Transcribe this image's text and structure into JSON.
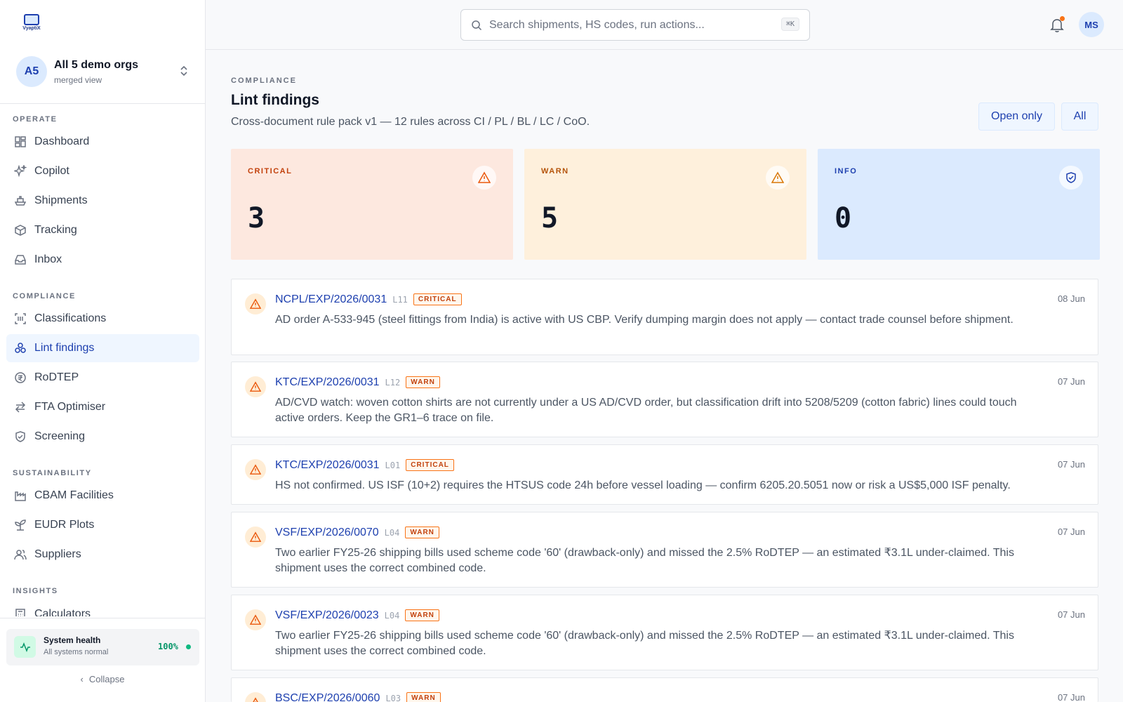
{
  "brand": {
    "logo_text": "VyaptiX"
  },
  "org": {
    "initials": "A5",
    "name": "All 5 demo orgs",
    "sub": "merged view"
  },
  "nav": {
    "operate": "OPERATE",
    "compliance": "COMPLIANCE",
    "sustainability": "SUSTAINABILITY",
    "insights": "INSIGHTS",
    "items": {
      "dashboard": "Dashboard",
      "copilot": "Copilot",
      "shipments": "Shipments",
      "tracking": "Tracking",
      "inbox": "Inbox",
      "classifications": "Classifications",
      "lint_findings": "Lint findings",
      "rodtep": "RoDTEP",
      "fta": "FTA Optimiser",
      "screening": "Screening",
      "cbam": "CBAM Facilities",
      "eudr": "EUDR Plots",
      "suppliers": "Suppliers",
      "calculators": "Calculators"
    }
  },
  "health": {
    "title": "System health",
    "sub": "All systems normal",
    "value": "100%"
  },
  "collapse": "Collapse",
  "search": {
    "placeholder": "Search shipments, HS codes, run actions...",
    "shortcut": "⌘K"
  },
  "user": {
    "initials": "MS"
  },
  "page": {
    "eyebrow": "COMPLIANCE",
    "title": "Lint findings",
    "subtitle": "Cross-document rule pack v1 — 12 rules across CI / PL / BL / LC / CoO.",
    "filters": {
      "open": "Open only",
      "all": "All"
    }
  },
  "stats": {
    "critical": {
      "label": "CRITICAL",
      "value": "3"
    },
    "warn": {
      "label": "WARN",
      "value": "5"
    },
    "info": {
      "label": "INFO",
      "value": "0"
    }
  },
  "findings": [
    {
      "ref": "NCPL/EXP/2026/0031",
      "code": "L11",
      "severity": "CRITICAL",
      "date": "08 Jun",
      "message": "AD order A-533-945 (steel fittings from India) is active with US CBP. Verify dumping margin does not apply — contact trade counsel before shipment."
    },
    {
      "ref": "KTC/EXP/2026/0031",
      "code": "L12",
      "severity": "WARN",
      "date": "07 Jun",
      "message": "AD/CVD watch: woven cotton shirts are not currently under a US AD/CVD order, but classification drift into 5208/5209 (cotton fabric) lines could touch active orders. Keep the GR1–6 trace on file."
    },
    {
      "ref": "KTC/EXP/2026/0031",
      "code": "L01",
      "severity": "CRITICAL",
      "date": "07 Jun",
      "message": "HS not confirmed. US ISF (10+2) requires the HTSUS code 24h before vessel loading — confirm 6205.20.5051 now or risk a US$5,000 ISF penalty."
    },
    {
      "ref": "VSF/EXP/2026/0070",
      "code": "L04",
      "severity": "WARN",
      "date": "07 Jun",
      "message": "Two earlier FY25-26 shipping bills used scheme code '60' (drawback-only) and missed the 2.5% RoDTEP — an estimated ₹3.1L under-claimed. This shipment uses the correct combined code."
    },
    {
      "ref": "VSF/EXP/2026/0023",
      "code": "L04",
      "severity": "WARN",
      "date": "07 Jun",
      "message": "Two earlier FY25-26 shipping bills used scheme code '60' (drawback-only) and missed the 2.5% RoDTEP — an estimated ₹3.1L under-claimed. This shipment uses the correct combined code."
    },
    {
      "ref": "BSC/EXP/2026/0060",
      "code": "L03",
      "severity": "WARN",
      "date": "07 Jun",
      "message": ""
    }
  ]
}
